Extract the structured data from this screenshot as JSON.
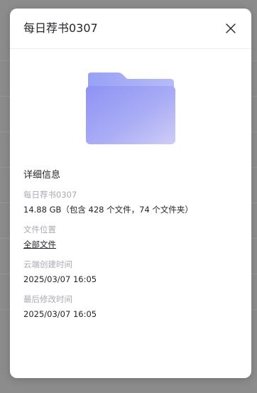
{
  "dialog": {
    "title": "每日荐书0307",
    "close_icon": "close-icon"
  },
  "folder": {
    "icon": "folder-icon",
    "colors": {
      "back": "#9aa3f5",
      "front_start": "#8e93f4",
      "front_end": "#cfcdf6"
    }
  },
  "details": {
    "heading": "详细信息",
    "name": "每日荐书0307",
    "size": "14.88 GB（包含 428 个文件，74 个文件夹）",
    "location_label": "文件位置",
    "location_value": "全部文件",
    "created_label": "云端创建时间",
    "created_value": "2025/03/07 16:05",
    "modified_label": "最后修改时间",
    "modified_value": "2025/03/07 16:05"
  },
  "colors": {
    "backdrop": "#8c8c8c",
    "dialog_bg": "#ffffff",
    "text_primary": "#25262b",
    "text_muted": "#a8abb2"
  }
}
